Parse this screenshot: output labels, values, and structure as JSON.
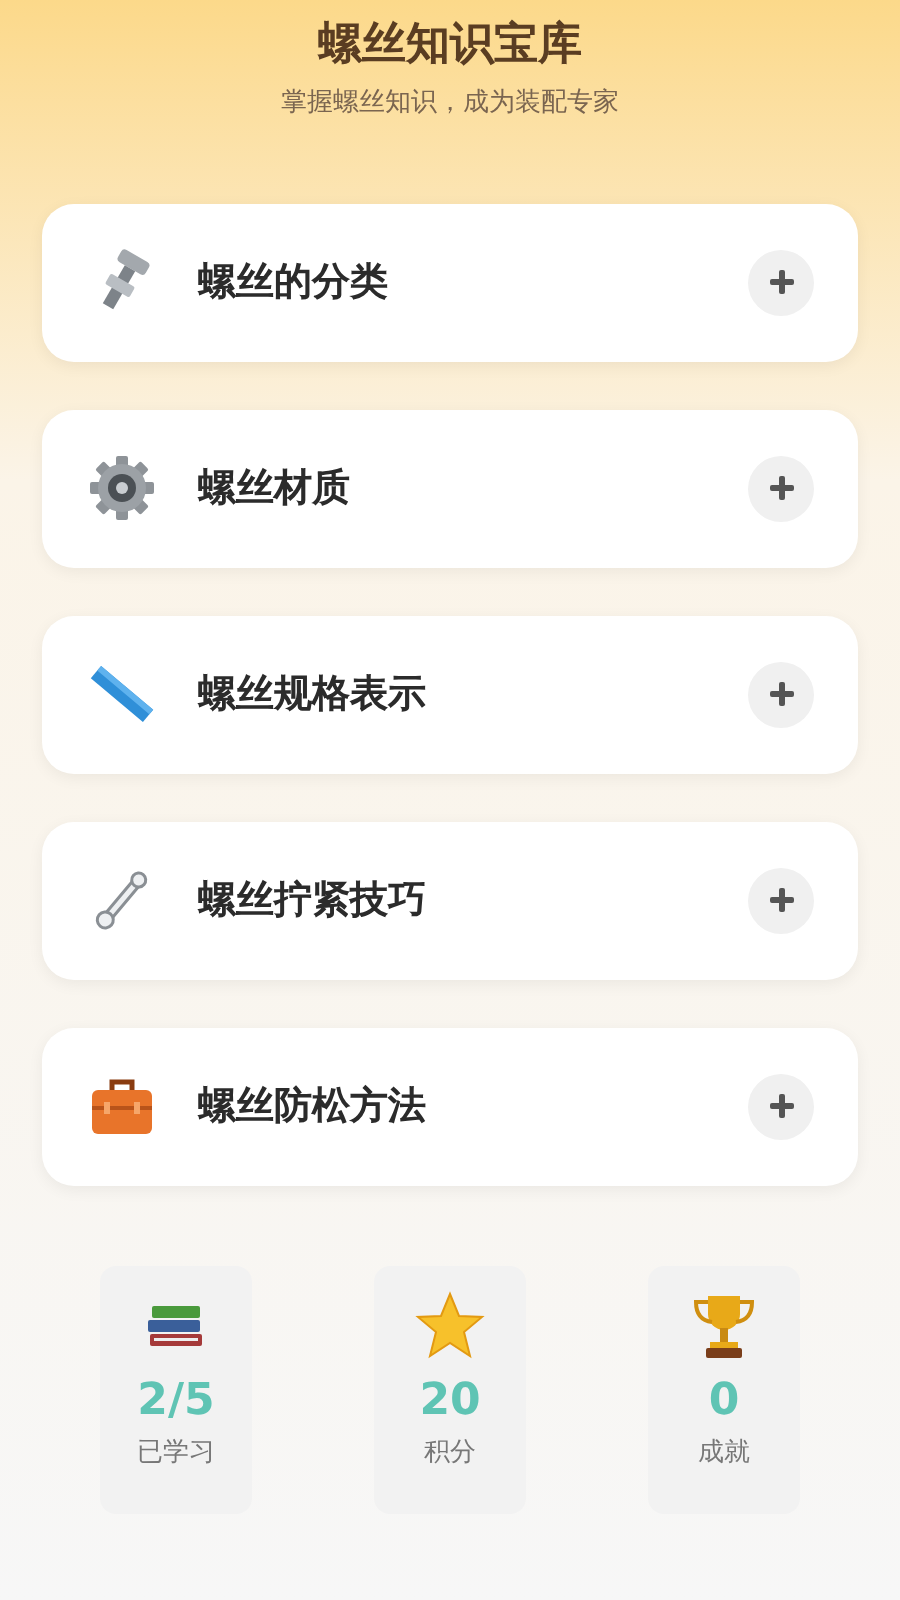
{
  "header": {
    "title": "螺丝知识宝库",
    "subtitle": "掌握螺丝知识，成为装配专家"
  },
  "topics": [
    {
      "label": "螺丝的分类",
      "expanded": false
    },
    {
      "label": "螺丝材质",
      "expanded": false
    },
    {
      "label": "螺丝规格表示",
      "expanded": false
    },
    {
      "label": "螺丝拧紧技巧",
      "expanded": false
    },
    {
      "label": "螺丝防松方法",
      "expanded": false
    }
  ],
  "stats": [
    {
      "value": "2/5",
      "label": "已学习"
    },
    {
      "value": "20",
      "label": "积分"
    },
    {
      "value": "0",
      "label": "成就"
    }
  ]
}
